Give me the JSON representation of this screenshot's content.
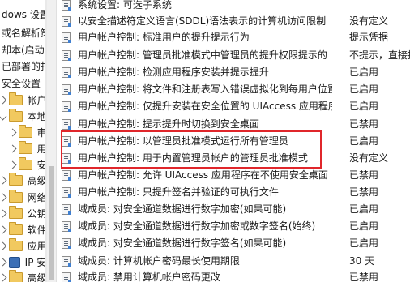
{
  "tree": {
    "items": [
      {
        "label": "dows 设置",
        "icon": "windows-settings-icon"
      },
      {
        "label": "或名解析策",
        "icon": "doc-icon"
      },
      {
        "label": "却本(启动",
        "icon": "doc-icon"
      },
      {
        "label": "已部署的打",
        "icon": "doc-icon"
      },
      {
        "label": "安全设置",
        "icon": "doc-icon"
      },
      {
        "label": "帐户策",
        "icon": "folder-icon"
      },
      {
        "label": "本地策",
        "icon": "folder-icon"
      },
      {
        "label": "审核",
        "icon": "folder-icon"
      },
      {
        "label": "用户",
        "icon": "folder-icon"
      },
      {
        "label": "安全",
        "icon": "folder-icon"
      },
      {
        "label": "高级安",
        "icon": "folder-icon"
      },
      {
        "label": "网络列",
        "icon": "folder-icon"
      },
      {
        "label": "公钥策",
        "icon": "folder-icon"
      },
      {
        "label": "软件限",
        "icon": "folder-icon"
      },
      {
        "label": "应用程",
        "icon": "folder-icon"
      },
      {
        "label": "IP 安全",
        "icon": "network-icon"
      },
      {
        "label": "高级审",
        "icon": "folder-icon"
      }
    ]
  },
  "policies": [
    {
      "name": "系统设置: 可选子系统",
      "setting": ""
    },
    {
      "name": "以安全描述符定义语言(SDDL)语法表示的计算机访问限制",
      "setting": "没有定义"
    },
    {
      "name": "用户帐户控制: 标准用户的提升提示行为",
      "setting": "提示凭据"
    },
    {
      "name": "用户帐户控制: 管理员批准模式中管理员的提升权限提示的",
      "setting": "不提示，直接提"
    },
    {
      "name": "用户帐户控制: 检测应用程序安装并提示提升",
      "setting": "已启用"
    },
    {
      "name": "用户帐户控制: 将文件和注册表写入错误虚拟化到每用户位置",
      "setting": "已启用"
    },
    {
      "name": "用户帐户控制: 仅提升安装在安全位置的 UIAccess 应用程序",
      "setting": "已启用"
    },
    {
      "name": "用户帐户控制: 提示提升时切换到安全桌面",
      "setting": "已禁用"
    },
    {
      "name": "用户帐户控制: 以管理员批准模式运行所有管理员",
      "setting": "已启用"
    },
    {
      "name": "用户帐户控制: 用于内置管理员帐户的管理员批准模式",
      "setting": "没有定义"
    },
    {
      "name": "用户帐户控制: 允许 UIAccess 应用程序在不使用安全桌面",
      "setting": "已禁用"
    },
    {
      "name": "用户帐户控制: 只提升签名并验证的可执行文件",
      "setting": "已禁用"
    },
    {
      "name": "域成员: 对安全通道数据进行数字加密(如果可能)",
      "setting": "已启用"
    },
    {
      "name": "域成员: 对安全通道数据进行数字加密或数字签名(始终)",
      "setting": "已启用"
    },
    {
      "name": "域成员: 对安全通道数据进行数字签名(如果可能)",
      "setting": "已启用"
    },
    {
      "name": "域成员: 计算机帐户密码最长使用期限",
      "setting": "30 天"
    },
    {
      "name": "域成员: 禁用计算机帐户密码更改",
      "setting": "已禁用"
    }
  ],
  "colors": {
    "highlight_border": "#e0262b"
  }
}
